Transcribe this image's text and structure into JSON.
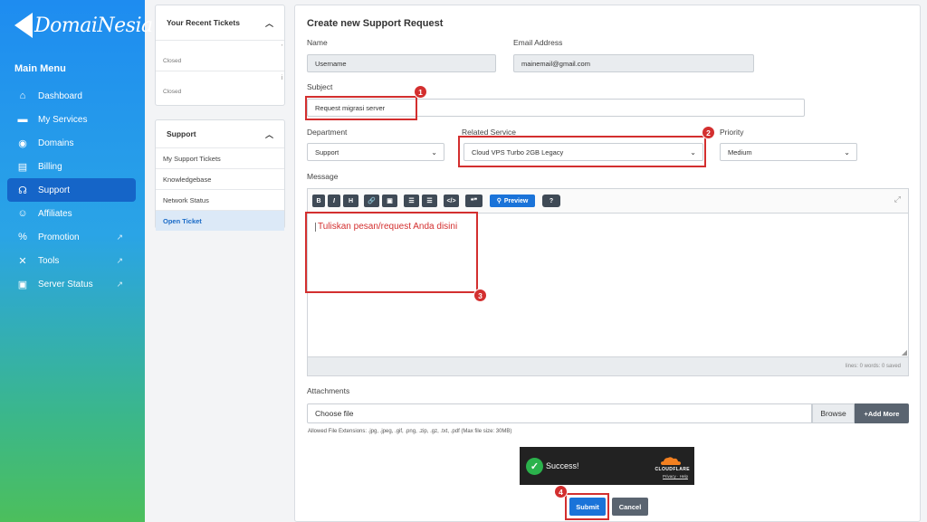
{
  "brand": {
    "name": "DomaiNesia"
  },
  "sidebar": {
    "title": "Main Menu",
    "items": [
      {
        "label": "Dashboard",
        "icon": "home-icon"
      },
      {
        "label": "My Services",
        "icon": "server-icon"
      },
      {
        "label": "Domains",
        "icon": "globe-icon"
      },
      {
        "label": "Billing",
        "icon": "invoice-icon"
      },
      {
        "label": "Support",
        "icon": "headset-icon",
        "active": true
      },
      {
        "label": "Affiliates",
        "icon": "users-icon"
      },
      {
        "label": "Promotion",
        "icon": "percent-icon",
        "external": true
      },
      {
        "label": "Tools",
        "icon": "tools-icon",
        "external": true
      },
      {
        "label": "Server Status",
        "icon": "monitor-icon",
        "external": true
      }
    ]
  },
  "recent_tickets": {
    "title": "Your Recent Tickets",
    "rows": [
      {
        "status": "Closed"
      },
      {
        "status": "Closed"
      }
    ]
  },
  "support_panel": {
    "title": "Support",
    "items": [
      "My Support Tickets",
      "Knowledgebase",
      "Network Status",
      "Open Ticket"
    ],
    "active_index": 3
  },
  "form": {
    "title": "Create new Support Request",
    "name_label": "Name",
    "name_value": "Username",
    "email_label": "Email Address",
    "email_value": "mainemail@gmail.com",
    "subject_label": "Subject",
    "subject_value": "Request migrasi server",
    "department_label": "Department",
    "department_value": "Support",
    "related_label": "Related Service",
    "related_value": "Cloud VPS Turbo 2GB Legacy",
    "priority_label": "Priority",
    "priority_value": "Medium",
    "message_label": "Message",
    "message_text": "Tuliskan pesan/request Anda disini",
    "toolbar": {
      "bold": "B",
      "italic": "I",
      "heading": "H",
      "link": "🔗",
      "image": "▣",
      "ul": "☰",
      "ol": "☰",
      "code": "</>",
      "quote": "❝❞",
      "preview": "Preview",
      "help": "?"
    },
    "status_text": "lines: 0   words: 0   saved",
    "attachments_label": "Attachments",
    "file_placeholder": "Choose file",
    "browse_label": "Browse",
    "addmore_label": "+Add More",
    "allowed_text": "Allowed File Extensions: .jpg, .jpeg, .gif, .png, .zip, .gz, .txt, .pdf (Max file size: 30MB)",
    "submit_label": "Submit",
    "cancel_label": "Cancel"
  },
  "captcha": {
    "status": "Success!",
    "provider": "CLOUDFLARE",
    "links": "Privacy · Help"
  },
  "annotations": {
    "b1": "1",
    "b2": "2",
    "b3": "3",
    "b4": "4"
  },
  "colors": {
    "accent": "#1a73d9",
    "annotation": "#d32f2f",
    "sidebar_top": "#1e8cf0",
    "sidebar_bottom": "#4cbf5c"
  }
}
